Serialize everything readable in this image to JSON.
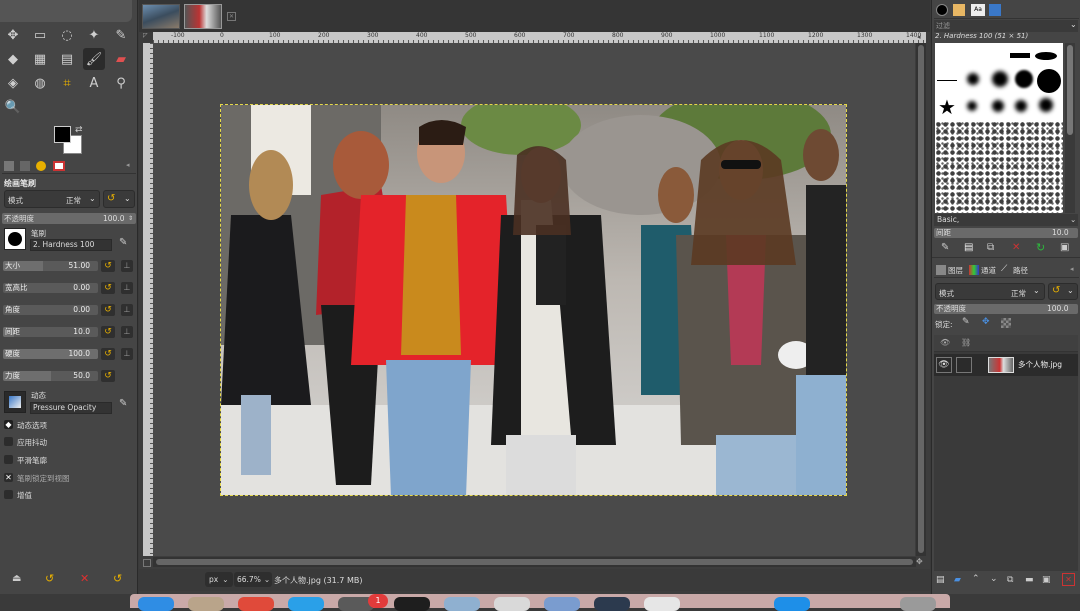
{
  "toolbox": {
    "title": "绘画笔刷",
    "mode_label": "模式",
    "mode_value": "正常",
    "opacity_label": "不透明度",
    "opacity_value": "100.0",
    "brush_label": "笔刷",
    "brush_name": "2. Hardness 100",
    "size_label": "大小",
    "size_value": "51.00",
    "size_fraction": 0.42,
    "aspect_label": "宽高比",
    "aspect_value": "0.00",
    "angle_label": "角度",
    "angle_value": "0.00",
    "spacing_label": "间距",
    "spacing_value": "10.0",
    "spacing_fraction": 0.12,
    "hardness_label": "硬度",
    "hardness_value": "100.0",
    "hardness_fraction": 1.0,
    "force_label": "力度",
    "force_value": "50.0",
    "force_fraction": 0.5,
    "dynamics_label": "动态",
    "dynamics_name": "Pressure Opacity",
    "dynamics_options": "动态选项",
    "apply_jitter": "应用抖动",
    "smooth_stroke": "平滑笔廓",
    "lock_brush": "笔刷锁定到视图",
    "incremental": "增值"
  },
  "canvas": {
    "ruler_labels": [
      "-100",
      "0",
      "100",
      "200",
      "300",
      "400",
      "500",
      "600",
      "700",
      "800",
      "900",
      "1000",
      "1100",
      "1200",
      "1300",
      "1400"
    ],
    "unit": "px",
    "zoom": "66.7%",
    "status": "多个人物.jpg (31.7 MB)"
  },
  "brushes": {
    "filter_label": "过滤",
    "current_brush": "2. Hardness 100 (51 × 51)",
    "preset": "Basic,",
    "spacing_label": "间距",
    "spacing_value": "10.0"
  },
  "layers": {
    "tab_layers": "图层",
    "tab_channels": "通道",
    "tab_paths": "路径",
    "mode_label": "模式",
    "mode_value": "正常",
    "opacity_label": "不透明度",
    "opacity_value": "100.0",
    "lock_label": "锁定:",
    "layer_name": "多个人物.jpg"
  },
  "dock": {
    "badge": "1"
  }
}
